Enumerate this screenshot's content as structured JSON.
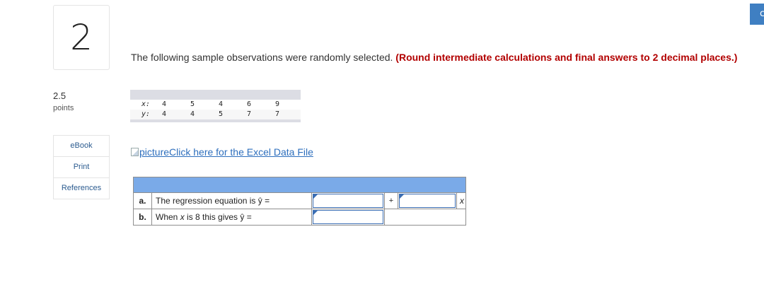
{
  "question": {
    "number": "2",
    "points_value": "2.5",
    "points_label": "points",
    "prompt_text": "The following sample observations were randomly selected.",
    "prompt_emphasis": "(Round intermediate calculations and final answers to 2 decimal places.)"
  },
  "sidebar": {
    "links": [
      "eBook",
      "Print",
      "References"
    ]
  },
  "top_button": {
    "icon": "chevron-icon",
    "label": "c"
  },
  "observations": {
    "x_label": "x:",
    "y_label": "y:",
    "x_values": [
      "4",
      "5",
      "4",
      "6",
      "9"
    ],
    "y_values": [
      "4",
      "4",
      "5",
      "7",
      "7"
    ]
  },
  "excel_link": {
    "img_alt": "picture",
    "text": "Click here for the Excel Data File"
  },
  "answers": {
    "rows": [
      {
        "letter": "a.",
        "text": "The regression equation is ŷ =",
        "plus": "+",
        "var": "x"
      },
      {
        "letter": "b.",
        "text_before": "When ",
        "text_var": "x",
        "text_after": " is 8 this gives ŷ ="
      }
    ]
  },
  "colors": {
    "emphasis": "#b20000",
    "link": "#2e6fbd",
    "table_header": "#7aaae8",
    "input_border": "#3a6db3",
    "button": "#3f7fc2"
  }
}
